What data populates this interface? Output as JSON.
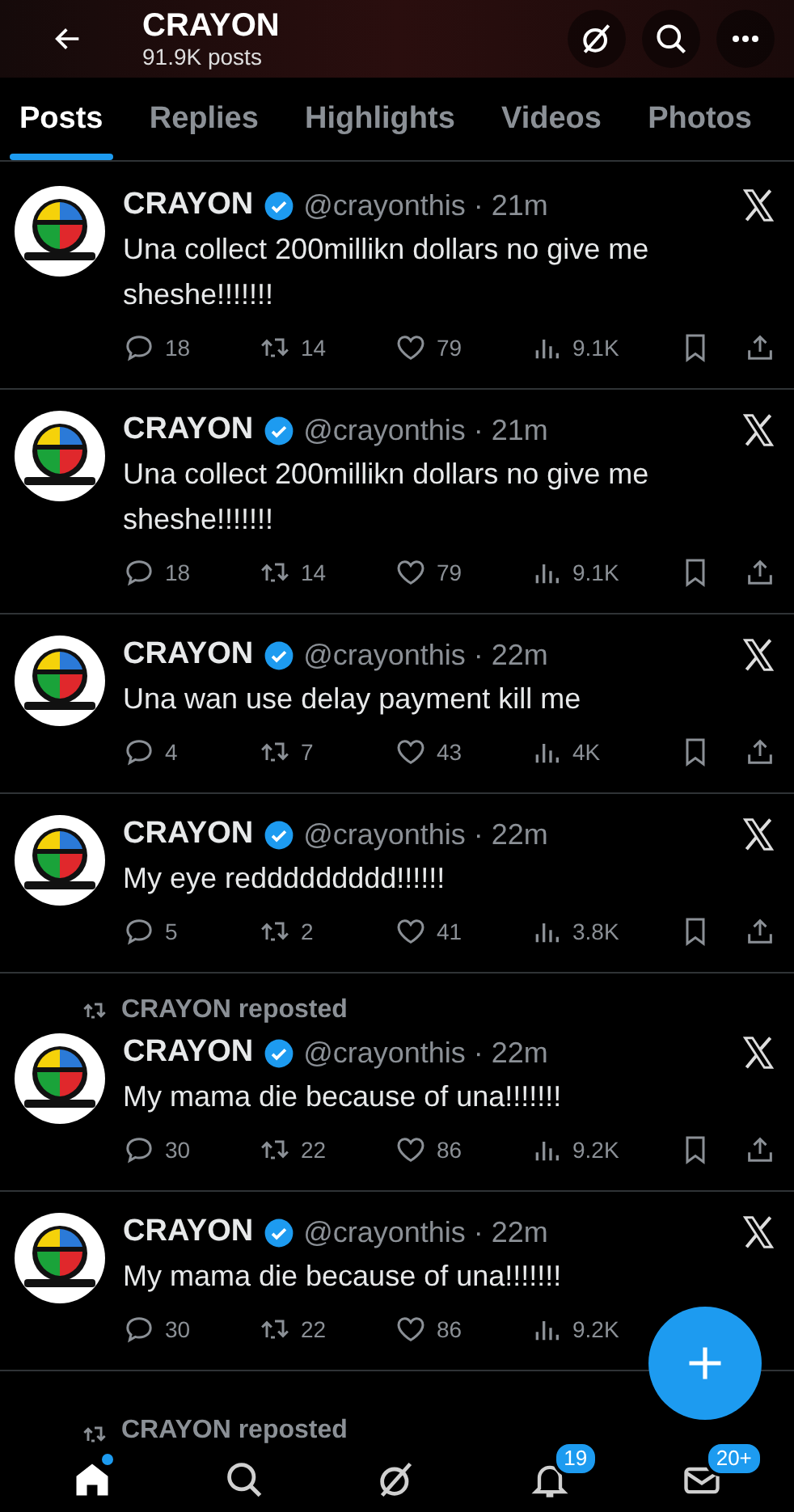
{
  "header": {
    "title": "CRAYON",
    "subtitle": "91.9K posts"
  },
  "tabs": [
    {
      "label": "Posts",
      "selected": true
    },
    {
      "label": "Replies",
      "selected": false
    },
    {
      "label": "Highlights",
      "selected": false
    },
    {
      "label": "Videos",
      "selected": false
    },
    {
      "label": "Photos",
      "selected": false
    }
  ],
  "posts": [
    {
      "name": "CRAYON",
      "meta": "@crayonthis · 21m",
      "text": "Una collect 200millikn dollars no give me sheshe!!!!!!!",
      "replies": "18",
      "reposts": "14",
      "likes": "79",
      "views": "9.1K",
      "bookmark_share": true
    },
    {
      "name": "CRAYON",
      "meta": "@crayonthis · 21m",
      "text": "Una collect 200millikn dollars no give me sheshe!!!!!!!",
      "replies": "18",
      "reposts": "14",
      "likes": "79",
      "views": "9.1K",
      "bookmark_share": true
    },
    {
      "name": "CRAYON",
      "meta": "@crayonthis · 22m",
      "text": "Una wan use delay payment kill me",
      "replies": "4",
      "reposts": "7",
      "likes": "43",
      "views": "4K",
      "bookmark_share": true
    },
    {
      "name": "CRAYON",
      "meta": "@crayonthis · 22m",
      "text": "My eye reddddddddd!!!!!!",
      "replies": "5",
      "reposts": "2",
      "likes": "41",
      "views": "3.8K",
      "bookmark_share": true
    },
    {
      "repost_label": "CRAYON reposted",
      "name": "CRAYON",
      "meta": "@crayonthis · 22m",
      "text": "My mama die because of una!!!!!!!",
      "replies": "30",
      "reposts": "22",
      "likes": "86",
      "views": "9.2K",
      "bookmark_share": true
    },
    {
      "name": "CRAYON",
      "meta": "@crayonthis · 22m",
      "text": "My mama die because of una!!!!!!!",
      "replies": "30",
      "reposts": "22",
      "likes": "86",
      "views": "9.2K",
      "bookmark_share": false
    }
  ],
  "next_repost_label": "CRAYON reposted",
  "nav": [
    {
      "kind": "home",
      "selected": true,
      "dot": true
    },
    {
      "kind": "search",
      "selected": false,
      "dot": false
    },
    {
      "kind": "grok",
      "selected": false,
      "dot": false
    },
    {
      "kind": "bell",
      "selected": false,
      "dot": false,
      "badge": "19"
    },
    {
      "kind": "mail",
      "selected": false,
      "dot": false,
      "badge": "20+"
    }
  ]
}
